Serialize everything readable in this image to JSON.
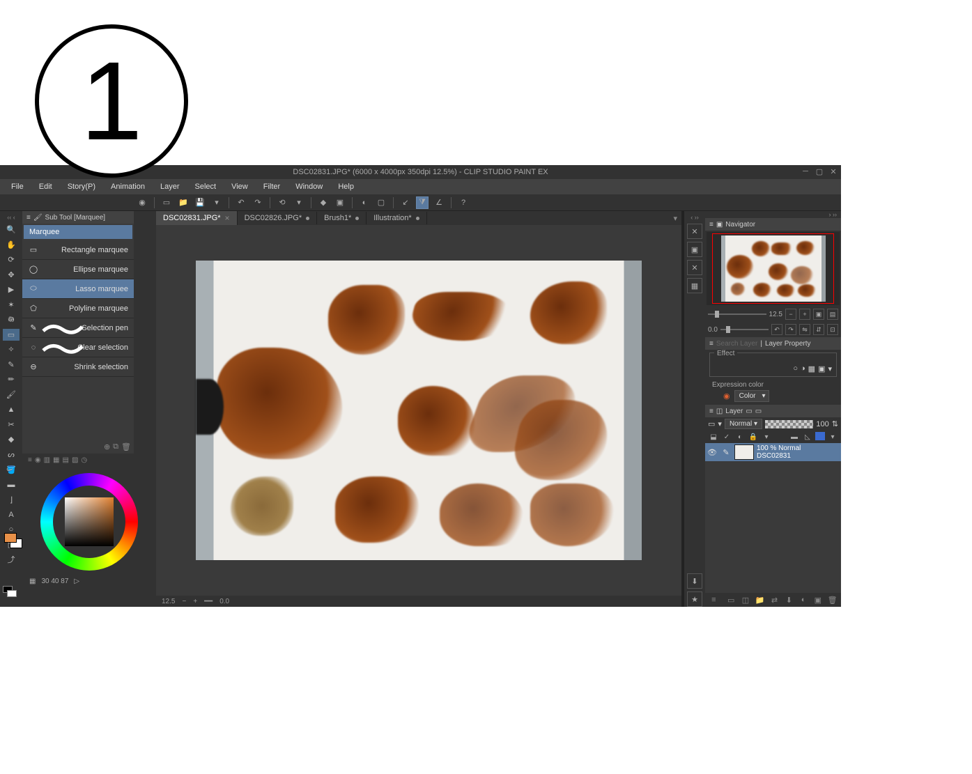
{
  "badge_number": "1",
  "titlebar": "DSC02831.JPG* (6000 x 4000px 350dpi 12.5%)  -  CLIP STUDIO PAINT EX",
  "menu": [
    "File",
    "Edit",
    "Story(P)",
    "Animation",
    "Layer",
    "Select",
    "View",
    "Filter",
    "Window",
    "Help"
  ],
  "subtool": {
    "header": "Sub Tool [Marquee]",
    "tab": "Marquee",
    "items": [
      {
        "label": "Rectangle marquee",
        "icon": "rect"
      },
      {
        "label": "Ellipse marquee",
        "icon": "ellipse"
      },
      {
        "label": "Lasso marquee",
        "icon": "lasso",
        "selected": true
      },
      {
        "label": "Polyline marquee",
        "icon": "poly"
      },
      {
        "label": "Selection pen",
        "icon": "pen"
      },
      {
        "label": "Clear selection",
        "icon": "erase"
      },
      {
        "label": "Shrink selection",
        "icon": "shrink"
      }
    ]
  },
  "color_info": {
    "values": "30  40  87"
  },
  "tabs": [
    {
      "label": "DSC02831.JPG*",
      "active": true,
      "mod": true
    },
    {
      "label": "DSC02826.JPG*",
      "mod": true
    },
    {
      "label": "Brush1*",
      "mod": true
    },
    {
      "label": "Illustration*",
      "mod": true
    }
  ],
  "navigator": {
    "title": "Navigator",
    "zoom": "12.5",
    "rotation": "0.0"
  },
  "layer_property": {
    "title": "Layer Property",
    "search": "Search Layer",
    "effect_label": "Effect",
    "expr_label": "Expression color",
    "expr_value": "Color"
  },
  "layer_panel": {
    "title": "Layer",
    "blend": "Normal",
    "opacity": "100",
    "layer": {
      "opacity_line": "100 % Normal",
      "name": "DSC02831"
    }
  },
  "canvas_footer": {
    "zoom": "12.5",
    "rotation": "0.0"
  }
}
